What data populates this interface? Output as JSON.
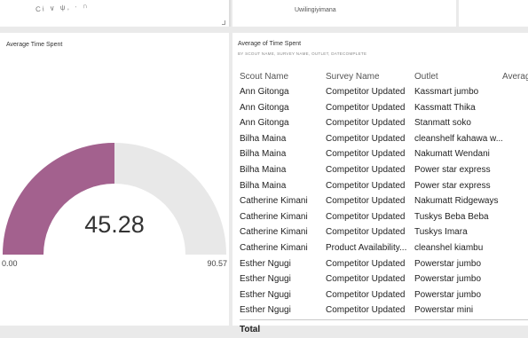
{
  "top_left": {
    "garbled_text": "Ci   ∨   ψ,   ·   ∩"
  },
  "top_mid": {
    "text": "Uwilingiyimana"
  },
  "gauge": {
    "title": "Average Time Spent",
    "value_label": "45.28",
    "min_label": "0.00",
    "max_label": "90.57",
    "value": 45.28,
    "min": 0,
    "max": 90.57,
    "fill_color": "#a3618e",
    "track_color": "#e8e8e8"
  },
  "table": {
    "title": "Average of Time Spent",
    "subtitle": "BY SCOUT NAME, SURVEY NAME, OUTLET, DATECOMPLETE",
    "headers": {
      "scout": "Scout Name",
      "survey": "Survey Name",
      "outlet": "Outlet",
      "avg": "Averag"
    },
    "rows": [
      [
        "Ann Gitonga",
        "Competitor Updated",
        "Kassmart jumbo"
      ],
      [
        "Ann Gitonga",
        "Competitor Updated",
        "Kassmatt Thika"
      ],
      [
        "Ann Gitonga",
        "Competitor Updated",
        "Stanmatt soko"
      ],
      [
        "Bilha Maina",
        "Competitor Updated",
        "cleanshelf kahawa w..."
      ],
      [
        "Bilha Maina",
        "Competitor Updated",
        "Nakumatt Wendani"
      ],
      [
        "Bilha Maina",
        "Competitor Updated",
        "Power star express"
      ],
      [
        "Bilha Maina",
        "Competitor Updated",
        "Power star express"
      ],
      [
        "Catherine Kimani",
        "Competitor Updated",
        "Nakumatt Ridgeways"
      ],
      [
        "Catherine Kimani",
        "Competitor Updated",
        "Tuskys Beba Beba"
      ],
      [
        "Catherine Kimani",
        "Competitor Updated",
        "Tuskys Imara"
      ],
      [
        "Catherine Kimani",
        "Product Availability...",
        "cleanshel kiambu"
      ],
      [
        "Esther Ngugi",
        "Competitor Updated",
        " Powerstar jumbo"
      ],
      [
        "Esther Ngugi",
        "Competitor Updated",
        " Powerstar jumbo"
      ],
      [
        "Esther Ngugi",
        "Competitor Updated",
        " Powerstar jumbo"
      ],
      [
        "Esther Ngugi",
        "Competitor Updated",
        " Powerstar mini"
      ]
    ],
    "total_label": "Total"
  }
}
